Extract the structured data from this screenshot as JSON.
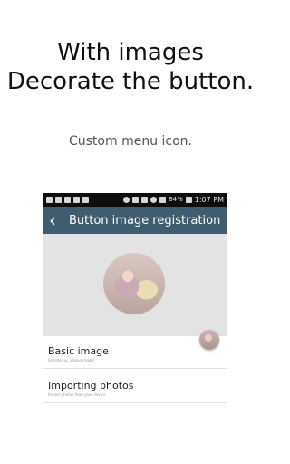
{
  "headline": {
    "line1": "With images",
    "line2": "Decorate the button."
  },
  "subline": "Custom menu icon.",
  "statusbar": {
    "battery": "84%",
    "time": "1:07 PM"
  },
  "actionbar": {
    "title": "Button image registration",
    "back_icon": "back-arrow-icon",
    "color": "#3f5d6f"
  },
  "list": [
    {
      "title": "Basic image",
      "subtitle": "Register as a base image"
    },
    {
      "title": "Importing photos",
      "subtitle": "Import photos from your device"
    }
  ]
}
